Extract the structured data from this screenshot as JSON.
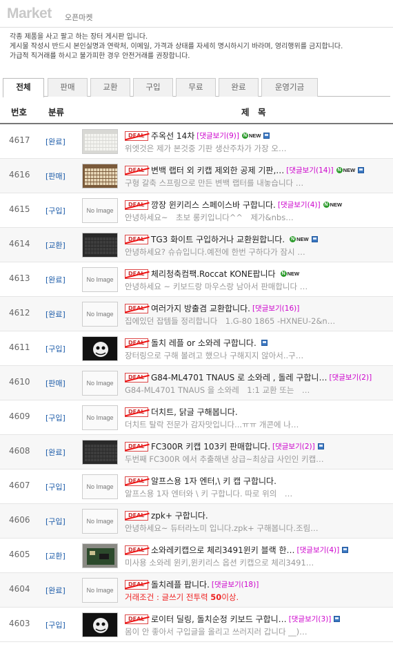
{
  "header": {
    "logo": "Market",
    "subtitle": "오픈마켓"
  },
  "notice": [
    "각종 제품을 사고 팔고 하는 장터 게시판 입니다.",
    "게시물 작성시 반드시 본인실명과 연락처, 이메일, 가격과 상태를 자세히 명시하시기 바라며, 영리행위를 금지합니다.",
    "가급적 직거래를 하시고 불가피한 경우 안전거래를 권장합니다."
  ],
  "tabs": [
    "전체",
    "판매",
    "교환",
    "구입",
    "무료",
    "완료",
    "운영기금"
  ],
  "columns": {
    "num": "번호",
    "cat": "분류",
    "title": "제　목"
  },
  "badge_text": "DEAL",
  "new_text": "NEW",
  "noimage_text": "No Image",
  "rows": [
    {
      "num": "4617",
      "cat": "[완료]",
      "title": "주옥선 14차",
      "comments": "[댓글보기(9)]",
      "preview": "위엣것은 제가 본것중 기판 생산주차가 가장 오…"
    },
    {
      "num": "4616",
      "cat": "[판매]",
      "title": "변백 랩터 외 키캡 제외한 공제 기판,…",
      "comments": "[댓글보기(14)]",
      "preview": "구형 갈축 스프링으로 만든 변백 랩터를 내놓습니다 …"
    },
    {
      "num": "4615",
      "cat": "[구입]",
      "title": "깡장 윈키리스 스페이스바 구합니다.",
      "comments": "[댓글보기(4)]",
      "preview": "안녕하세요~　초보 롱키입니다^^　제가&nbs…"
    },
    {
      "num": "4614",
      "cat": "[교환]",
      "title": "TG3 화이트 구입하거나 교환원합니다.",
      "comments": "",
      "preview": "안녕하세요? 슈슈입니다.예전에 한번 구하다가 잠시 …"
    },
    {
      "num": "4613",
      "cat": "[완료]",
      "title": "체리청축컴팩.Roccat KONE팝니다",
      "comments": "",
      "preview": "안녕하세요 ~ 키보드랑 마우스랑 남아서 판매합니다 …"
    },
    {
      "num": "4612",
      "cat": "[완료]",
      "title": "여러가지 방출겸 교환합니다.",
      "comments": "[댓글보기(16)]",
      "preview": "집에있던 잡템들 정리합니다　1.G-80 1865 -HXNEU-2&n…"
    },
    {
      "num": "4611",
      "cat": "[구입]",
      "title": "돌치 레플 or 소와레 구합니다.",
      "comments": "",
      "preview": "장터링으로 구해 볼려고 했으나 구해지지 않아서..구…"
    },
    {
      "num": "4610",
      "cat": "[판매]",
      "title": "G84-ML4701 TNAUS 로 소와레 , 돌레 구합니…",
      "comments": "[댓글보기(2)]",
      "preview": "G84-ML4701 TNAUS 을 소와레　1:1 교환 또는　…"
    },
    {
      "num": "4609",
      "cat": "[구입]",
      "title": "더치트, 닭글 구해봅니다.",
      "comments": "",
      "preview": "더치트 탈락 전문가 감자맛입니다...ㅠㅠ 개콘에 나…"
    },
    {
      "num": "4608",
      "cat": "[완료]",
      "title": "FC300R 키캡 103키 판매합니다.",
      "comments": "[댓글보기(2)]",
      "preview": "두번째 FC300R 에서 추출해낸 상급~최상급 사인인 키캡…"
    },
    {
      "num": "4607",
      "cat": "[구입]",
      "title": "알프스용 1자 엔터,\\ 키 캡 구합니다.",
      "comments": "",
      "preview": "알프스용 1자 엔터와 \\ 키 구합니다. 따로 위의　…"
    },
    {
      "num": "4606",
      "cat": "[구입]",
      "title": "zpk+ 구합니다.",
      "comments": "",
      "preview": "안녕하세요~ 듀터라노미 입니다.zpk+ 구해봅니다.조림…"
    },
    {
      "num": "4605",
      "cat": "[교환]",
      "title": "소와레키캡으로 체리3491윈키 블랙 한…",
      "comments": "[댓글보기(4)]",
      "preview": "미사용 소와레 윈키,윈키리스 옵션 키캡으로 체리3491…"
    },
    {
      "num": "4604",
      "cat": "[완료]",
      "title": "돌치레플 팝니다.",
      "comments": "[댓글보기(18)]",
      "preview_prefix": "거래조건 : 글쓰기 전투력 ",
      "preview_bold": "50",
      "preview_suffix": "이상."
    },
    {
      "num": "4603",
      "cat": "[구입]",
      "title": "로이터 딜링, 돌치순정 키보드 구합니…",
      "comments": "[댓글보기(3)]",
      "preview": "몸이 안 좋아서 구입글을 올리고 쓰러지러 갑니다 __)…"
    }
  ]
}
